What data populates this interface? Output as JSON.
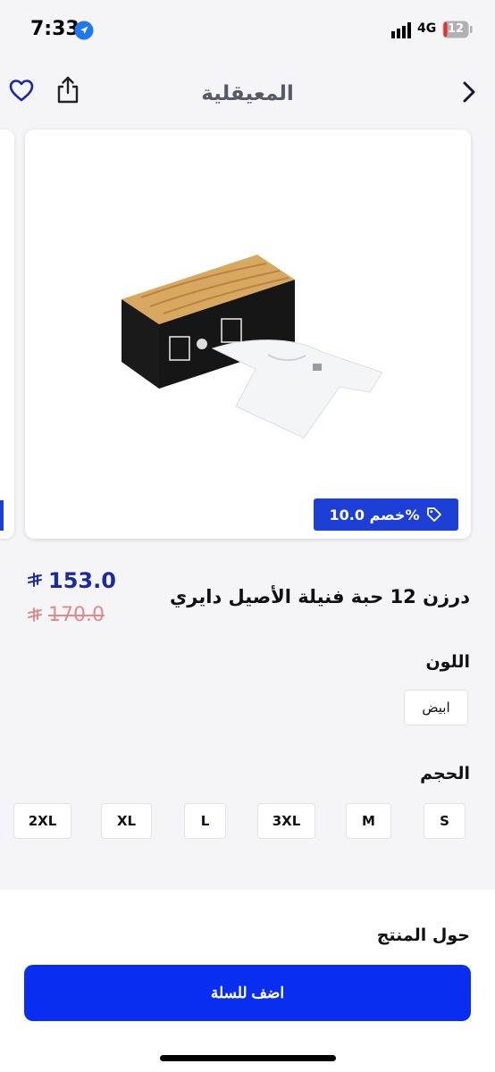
{
  "status_bar": {
    "time": "7:33",
    "network": "4G",
    "battery": "12"
  },
  "nav": {
    "title": "المعيقلية"
  },
  "product": {
    "discount_label": "خصم 10.0%",
    "price_current": "153.0",
    "price_old": "170.0",
    "title": "درزن 12 حبة فنيلة الأصيل دايري"
  },
  "color_section": {
    "label": "اللون",
    "options": [
      "ابيض"
    ]
  },
  "size_section": {
    "label": "الحجم",
    "options": [
      "S",
      "M",
      "3XL",
      "L",
      "XL",
      "2XL"
    ]
  },
  "about": {
    "label": "حول المنتج"
  },
  "cart": {
    "button_label": "اضف للسلة"
  },
  "colors": {
    "accent": "#0a2ef0",
    "badge": "#1d3fd6",
    "price": "#1b2a9e",
    "old_price": "#e08a8a"
  }
}
